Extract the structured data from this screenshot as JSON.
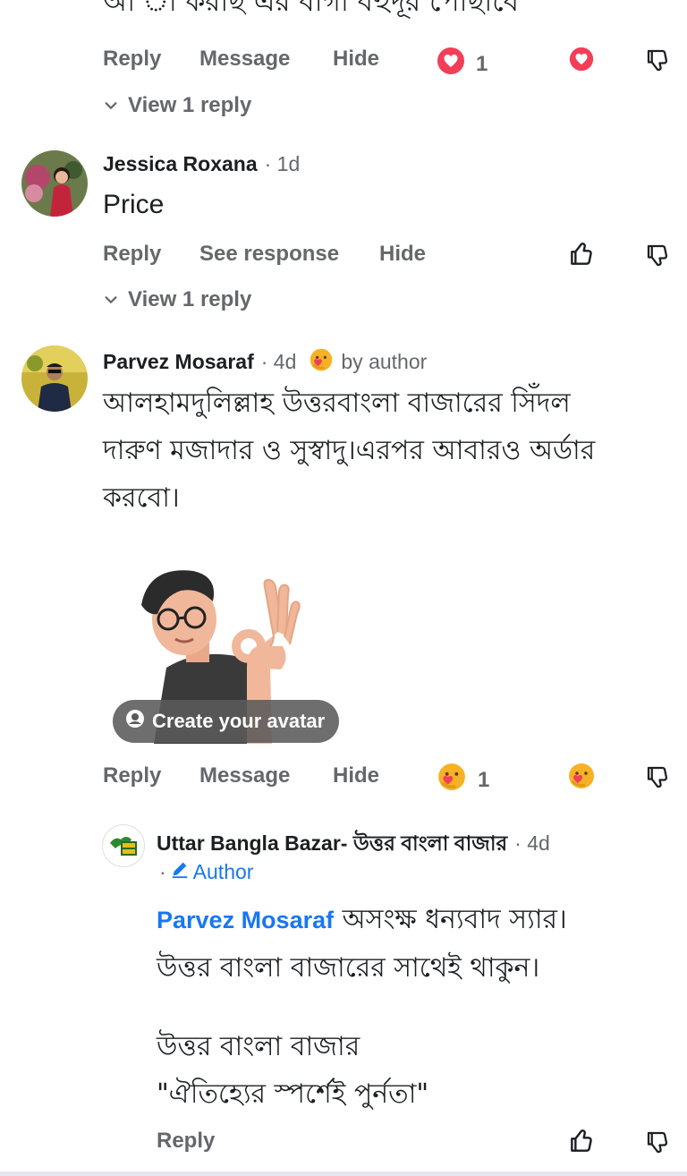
{
  "top_comment": {
    "cut_text": "আ া করছি এর বাগা বহুদূর পৌছাবে",
    "actions": {
      "reply": "Reply",
      "message": "Message",
      "hide": "Hide"
    },
    "reaction_count": "1",
    "view_replies": "View 1 reply"
  },
  "comment_jessica": {
    "name": "Jessica Roxana",
    "time": "· 1d",
    "text": "Price",
    "actions": {
      "reply": "Reply",
      "see_response": "See response",
      "hide": "Hide"
    },
    "view_replies": "View 1 reply"
  },
  "comment_parvez": {
    "name": "Parvez Mosaraf",
    "time": "· 4d",
    "reaction_tag": "by author",
    "text_line1": "আলহামদুলিল্লাহ উত্তরবাংলা বাজারের সিঁদল",
    "text_line2": "দারুণ মজাদার ও সুস্বাদু।এরপর আবারও অর্ডার",
    "text_line3": "করবো।",
    "avatar_cta": "Create your avatar",
    "actions": {
      "reply": "Reply",
      "message": "Message",
      "hide": "Hide"
    },
    "reaction_count": "1"
  },
  "reply_page": {
    "name": "Uttar Bangla Bazar- উত্তর বাংলা বাজার",
    "time": "· 4d",
    "author_label": "Author",
    "mention": "Parvez Mosaraf",
    "text_line1": " অসংক্ষ ধন্যবাদ স্যার।",
    "text_line2": "উত্তর বাংলা বাজারের সাথেই থাকুন।",
    "text_line3": "উত্তর বাংলা বাজার",
    "text_line4": "\"ঐতিহ্যের স্পর্শেই পুর্নতা\"",
    "actions": {
      "reply": "Reply"
    }
  },
  "colors": {
    "secondary_text": "#65676b",
    "primary_text": "#1c1e21",
    "link_blue": "#1877f2",
    "love_red": "#f33e58"
  },
  "icons": [
    "love-reaction-icon",
    "thumbs-down-icon",
    "thumbs-up-icon",
    "chevron-down-icon",
    "care-reaction-icon",
    "pencil-icon",
    "avatar-icon"
  ]
}
